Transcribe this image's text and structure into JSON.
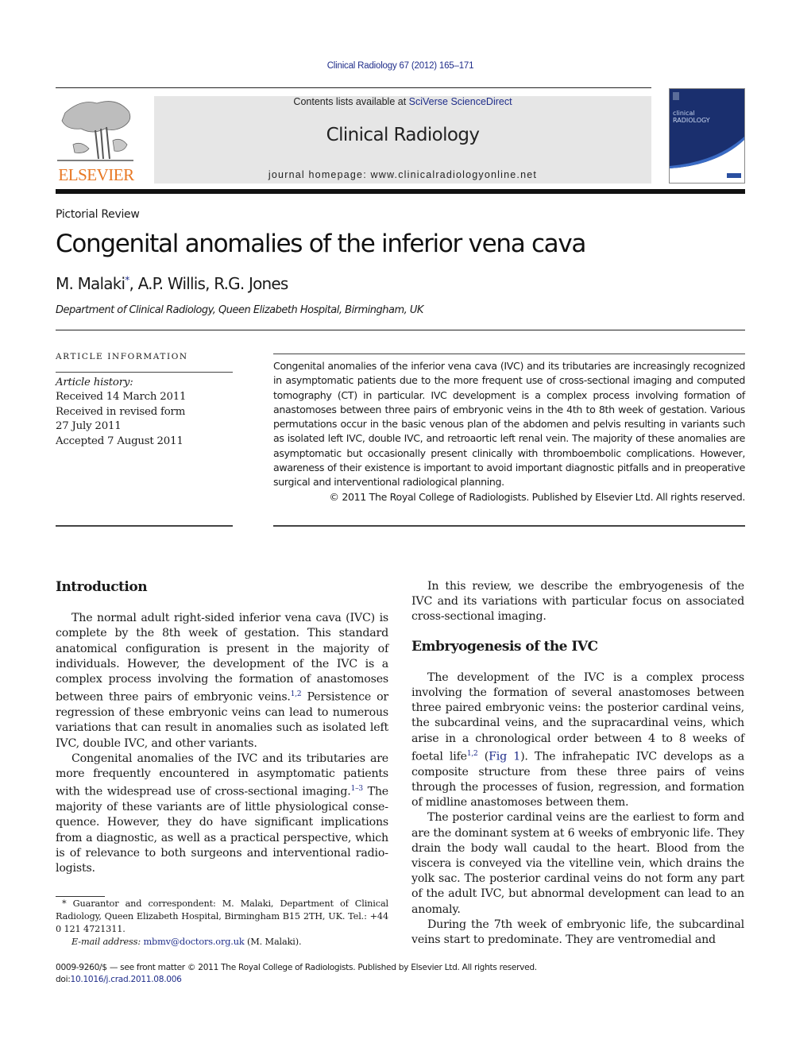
{
  "header": {
    "journal_ref": "Clinical Radiology 67 (2012) 165–171",
    "contents_prefix": "Contents lists available at ",
    "contents_link": "SciVerse ScienceDirect",
    "journal_title": "Clinical Radiology",
    "homepage_prefix": "journal homepage: ",
    "homepage_url": "www.clinicalradiologyonline.net",
    "publisher_logo_text": "ELSEVIER",
    "cover_title_top": "clinical",
    "cover_title_bottom": "RADIOLOGY",
    "colors": {
      "link": "#1f2d8a",
      "elsevier_orange": "#e87722",
      "masthead_bg": "#e6e6e6",
      "cover_blue": "#1a2f6e"
    }
  },
  "article": {
    "type": "Pictorial Review",
    "title": "Congenital anomalies of the inferior vena cava",
    "authors": [
      {
        "name": "M. Malaki",
        "mark": "*"
      },
      {
        "name": "A.P. Willis"
      },
      {
        "name": "R.G. Jones"
      }
    ],
    "affiliation": "Department of Clinical Radiology, Queen Elizabeth Hospital, Birmingham, UK"
  },
  "article_info": {
    "heading": "ARTICLE INFORMATION",
    "history_label": "Article history:",
    "history": [
      "Received 14 March 2011",
      "Received in revised form",
      "27 July 2011",
      "Accepted 7 August 2011"
    ]
  },
  "abstract": {
    "text": "Congenital anomalies of the inferior vena cava (IVC) and its tributaries are increasingly recognized in asymptomatic patients due to the more frequent use of cross-sectional imaging and computed tomography (CT) in particular. IVC development is a complex process involving formation of anastomoses between three pairs of embryonic veins in the 4th to 8th week of gestation. Various permutations occur in the basic venous plan of the abdomen and pelvis resulting in variants such as isolated left IVC, double IVC, and retroaortic left renal vein. The majority of these anomalies are asymptomatic but occasionally present clinically with thromboembolic complications. However, awareness of their existence is important to avoid important diagnostic pitfalls and in preoperative surgical and interventional radiological planning.",
    "copyright": "© 2011 The Royal College of Radiologists. Published by Elsevier Ltd. All rights reserved."
  },
  "body": {
    "intro_heading": "Introduction",
    "intro_p1_a": "The normal adult right-sided inferior vena cava (IVC) is complete by the 8th week of gestation. This standard anatomical configuration is present in the majority of individuals. However, the development of the IVC is a complex process involving the formation of anastomoses between three pairs of embryonic veins.",
    "intro_p1_ref": "1,2",
    "intro_p1_b": " Persistence or regression of these embryonic veins can lead to numerous variations that can result in anomalies such as isolated left IVC, double IVC, and other variants.",
    "intro_p2_a": "Congenital anomalies of the IVC and its tributaries are more frequently encountered in asymptomatic patients with the widespread use of cross-sectional imaging.",
    "intro_p2_ref": "1–3",
    "intro_p2_b": " The majority of these variants are of little physiological conse­quence. However, they do have significant implications from a diagnostic, as well as a practical perspective, which is of relevance to both surgeons and interventional radio­logists.",
    "review_p": "In this review, we describe the embryogenesis of the IVC and its variations with particular focus on associated cross-sectional imaging.",
    "embryo_heading": "Embryogenesis of the IVC",
    "embryo_p1_a": "The development of the IVC is a complex process involving the formation of several anastomoses between three paired embryonic veins: the posterior cardinal veins, the subcardinal veins, and the supracardinal veins, which arise in a chronological order between 4 to 8 weeks of foetal life",
    "embryo_p1_ref": "1,2",
    "embryo_p1_fig_open": " (",
    "embryo_p1_fig": "Fig 1",
    "embryo_p1_b": "). The infrahepatic IVC develops as a composite structure from these three pairs of veins through the processes of fusion, regression, and formation of midline anastomoses between them.",
    "embryo_p2": "The posterior cardinal veins are the earliest to form and are the dominant system at 6 weeks of embryonic life. They drain the body wall caudal to the heart. Blood from the viscera is conveyed via the vitelline vein, which drains the yolk sac. The posterior cardinal veins do not form any part of the adult IVC, but abnormal development can lead to an anomaly.",
    "embryo_p3": "During the 7th week of embryonic life, the subcardinal veins start to predominate. They are ventromedial and"
  },
  "footnote": {
    "mark": "*",
    "text": " Guarantor and correspondent: M. Malaki, Department of Clinical Radiology, Queen Elizabeth Hospital, Birmingham B15 2TH, UK. Tel.: +44 0 121 4721311.",
    "email_label": "E-mail address:",
    "email": "mbmv@doctors.org.uk",
    "email_suffix": " (M. Malaki)."
  },
  "bottom": {
    "issn_line": "0009-9260/$ — see front matter © 2011 The Royal College of Radiologists. Published by Elsevier Ltd. All rights reserved.",
    "doi_label": "doi:",
    "doi": "10.1016/j.crad.2011.08.006"
  }
}
